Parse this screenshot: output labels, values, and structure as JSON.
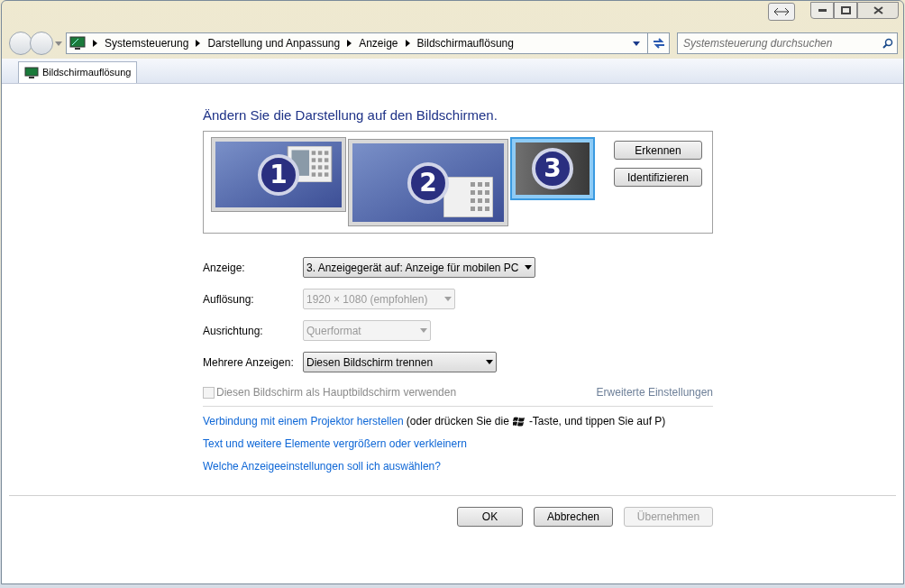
{
  "address_bar": {
    "crumbs": [
      "Systemsteuerung",
      "Darstellung und Anpassung",
      "Anzeige",
      "Bildschirmauflösung"
    ]
  },
  "search": {
    "placeholder": "Systemsteuerung durchsuchen"
  },
  "tab": {
    "label": "Bildschirmauflösung"
  },
  "heading": "Ändern Sie die Darstellung auf den Bildschirmen.",
  "monitors": [
    {
      "number": "1",
      "selected": false
    },
    {
      "number": "2",
      "selected": false
    },
    {
      "number": "3",
      "selected": true
    }
  ],
  "monitor_buttons": [
    "Erkennen",
    "Identifizieren"
  ],
  "fields": [
    {
      "label": "Anzeige:",
      "value": "3. Anzeigegerät auf: Anzeige für mobilen PC",
      "disabled": false
    },
    {
      "label": "Auflösung:",
      "value": "1920 × 1080 (empfohlen)",
      "disabled": true
    },
    {
      "label": "Ausrichtung:",
      "value": "Querformat",
      "disabled": true
    },
    {
      "label": "Mehrere Anzeigen:",
      "value": "Diesen Bildschirm trennen",
      "disabled": false
    }
  ],
  "primary_checkbox": {
    "label": "Diesen Bildschirm als Hauptbildschirm verwenden",
    "checked": false,
    "disabled": true
  },
  "advanced_link": "Erweiterte Einstellungen",
  "links": [
    {
      "link": "Verbindung mit einem Projektor herstellen",
      "note_before": "(oder drücken Sie die",
      "note_after": "-Taste, und tippen Sie auf P)"
    },
    {
      "link": "Text und weitere Elemente vergrößern oder verkleinern"
    },
    {
      "link": "Welche Anzeigeeinstellungen soll ich auswählen?"
    }
  ],
  "buttons": [
    {
      "label": "OK",
      "disabled": false
    },
    {
      "label": "Abbrechen",
      "disabled": false
    },
    {
      "label": "Übernehmen",
      "disabled": true
    }
  ]
}
